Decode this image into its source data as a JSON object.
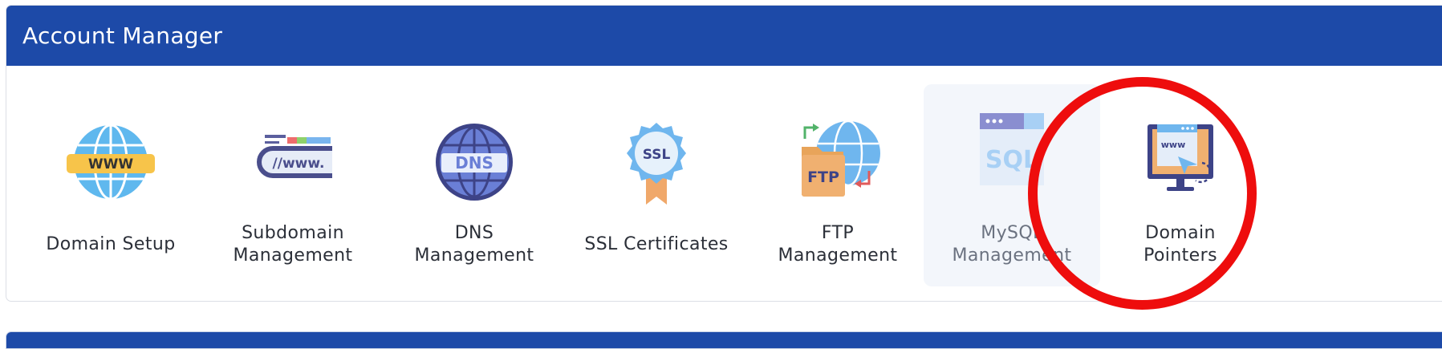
{
  "panel": {
    "title": "Account Manager"
  },
  "tiles": [
    {
      "label_line1": "Domain Setup",
      "label_line2": "",
      "icon": "www-globe-icon"
    },
    {
      "label_line1": "Subdomain",
      "label_line2": "Management",
      "icon": "subdomain-url-icon"
    },
    {
      "label_line1": "DNS",
      "label_line2": "Management",
      "icon": "dns-globe-icon"
    },
    {
      "label_line1": "SSL Certificates",
      "label_line2": "",
      "icon": "ssl-badge-icon"
    },
    {
      "label_line1": "FTP",
      "label_line2": "Management",
      "icon": "ftp-folder-icon"
    },
    {
      "label_line1": "MySQL",
      "label_line2": "Management",
      "icon": "sql-window-icon"
    },
    {
      "label_line1": "Domain",
      "label_line2": "Pointers",
      "icon": "domain-pointer-monitor-icon"
    }
  ],
  "icon_text": {
    "www": "WWW",
    "subdomain": "//www.",
    "dns": "DNS",
    "ssl": "SSL",
    "ftp": "FTP",
    "sql": "SQL",
    "pointer": "www"
  },
  "colors": {
    "header": "#1d4aa8",
    "highlight_circle": "#ee0d0d",
    "active_tile": "#f3f6fb"
  }
}
